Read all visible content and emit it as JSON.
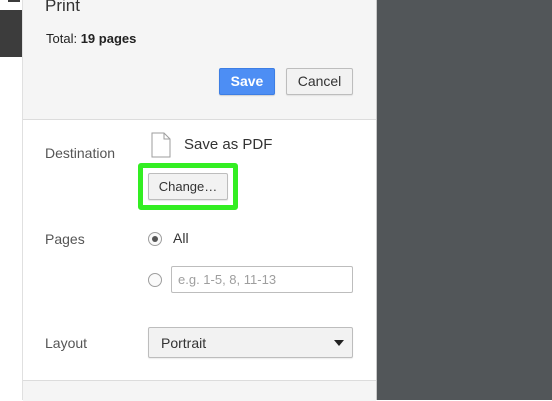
{
  "dialog": {
    "title": "Print",
    "total_label": "Total:",
    "total_value": "19 pages",
    "save_label": "Save",
    "cancel_label": "Cancel"
  },
  "destination": {
    "label": "Destination",
    "value": "Save as PDF",
    "change_label": "Change…",
    "icon": "file-icon"
  },
  "pages": {
    "label": "Pages",
    "all_label": "All",
    "all_selected": true,
    "custom_value": "",
    "custom_placeholder": "e.g. 1-5, 8, 11-13"
  },
  "layout": {
    "label": "Layout",
    "selected": "Portrait"
  },
  "colors": {
    "primary_button": "#4d8ef4",
    "highlight": "#33ee22",
    "preview_bg": "#525659"
  }
}
